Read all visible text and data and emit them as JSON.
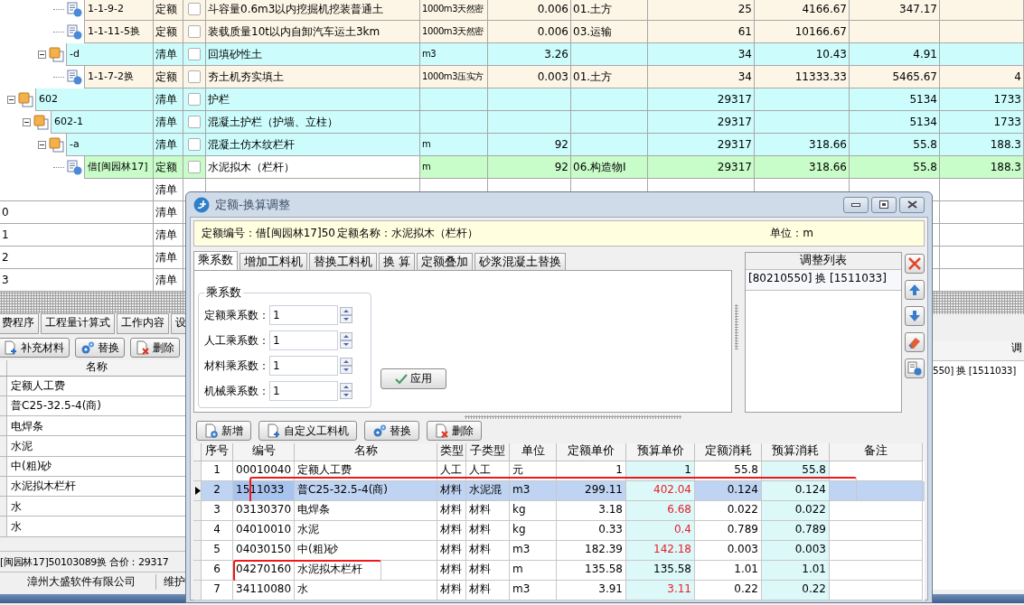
{
  "tree_grid": {
    "tree": [
      {
        "children": [
          {
            "children": [
              {
                "code": "1-1-9-2",
                "kind": "quota",
                "type": "定额",
                "checked": false,
                "name": "斗容量0.6m3以内挖掘机挖装普通土",
                "unit": "1000m3天然密",
                "qty": "0.006",
                "category": "01.土方",
                "col_8": "25",
                "col_9": "4166.67",
                "col_10": "347.17",
                "current": false
              },
              {
                "code": "1-1-11-5换",
                "kind": "quota",
                "type": "定额",
                "checked": false,
                "name": "装载质量10t以内自卸汽车运土3km",
                "unit": "1000m3天然密",
                "qty": "0.006",
                "category": "03.运输",
                "col_8": "61",
                "col_9": "10166.67",
                "current": false
              }
            ]
          },
          {
            "code": "-d",
            "kind": "list",
            "type": "清单",
            "checked": false,
            "expanded": true,
            "name": "回填砂性土",
            "unit": "m3",
            "qty": "3.26",
            "col_8": "34",
            "col_9": "10.43",
            "col_10": "4.91",
            "current": false,
            "children": [
              {
                "code": "1-1-7-2换",
                "kind": "quota",
                "type": "定额",
                "checked": false,
                "name": "夯土机夯实填土",
                "unit": "1000m3压实方",
                "qty": "0.003",
                "category": "01.土方",
                "col_8": "34",
                "col_9": "11333.33",
                "col_10": "5465.67",
                "col_11": "4",
                "current": false
              }
            ]
          }
        ]
      },
      {
        "code": "602",
        "kind": "list",
        "type": "清单",
        "checked": false,
        "expanded": true,
        "name": "护栏",
        "col_8": "29317",
        "col_10": "5134",
        "col_11": "1733",
        "current": false,
        "children": [
          {
            "code": "602-1",
            "kind": "list",
            "type": "清单",
            "checked": false,
            "expanded": true,
            "name": "混凝土护栏（护墙、立柱）",
            "col_8": "29317",
            "col_10": "5134",
            "col_11": "1733",
            "current": false,
            "children": [
              {
                "code": "-a",
                "kind": "list",
                "type": "清单",
                "checked": false,
                "expanded": true,
                "name": "混凝土仿木纹栏杆",
                "unit": "m",
                "qty": "92",
                "col_8": "29317",
                "col_9": "318.66",
                "col_10": "55.8",
                "col_11": "188.3",
                "current": false,
                "children": [
                  {
                    "code": "借[闽园林17]",
                    "kind": "quota",
                    "type": "定额",
                    "checked": false,
                    "name": "水泥拟木（栏杆）",
                    "unit": "m",
                    "qty": "92",
                    "category": "06.构造物Ⅰ",
                    "col_8": "29317",
                    "col_9": "318.66",
                    "col_10": "55.8",
                    "col_11": "188.3",
                    "current": true
                  }
                ]
              }
            ]
          }
        ]
      }
    ],
    "rows": [
      {
        "type": "清单"
      },
      {
        "code": "0",
        "type": "清单"
      },
      {
        "code": "1",
        "type": "清单"
      },
      {
        "code": "2",
        "type": "清单"
      },
      {
        "code": "3",
        "type": "清单"
      }
    ]
  },
  "lower_left": {
    "tabs": [
      {
        "label": "费程序",
        "selected": false
      },
      {
        "label": "工程量计算式",
        "selected": false
      },
      {
        "label": "工作内容",
        "selected": false
      },
      {
        "label": "设",
        "selected": false
      }
    ],
    "toolbar": [
      {
        "kind": "add",
        "label": "补充材料"
      },
      {
        "kind": "replace",
        "label": "替换"
      },
      {
        "kind": "delete",
        "label": "删除"
      }
    ],
    "column_header": "名称",
    "items": [
      "定额人工费",
      "普C25-32.5-4(商)",
      "电焊条",
      "水泥",
      "中(粗)砂",
      "水泥拟木栏杆",
      "水",
      "水"
    ],
    "summary": "[闽园林17]50103089换 合价：29317"
  },
  "status_bar": [
    "漳州大盛软件有限公司",
    "维护"
  ],
  "lower_right": {
    "header": "调",
    "item": "550] 换 [1511033]"
  },
  "dialog": {
    "title": "定额-换算调整",
    "info_code": "定额编号：借[闽园林17]50",
    "info_name": "定额名称：水泥拟木（栏杆）",
    "info_unit": "单位：m",
    "tabs": [
      {
        "label": "乘系数",
        "selected": true
      },
      {
        "label": "增加工料机",
        "selected": false
      },
      {
        "label": "替换工料机",
        "selected": false
      },
      {
        "label": "换 算",
        "selected": false
      },
      {
        "label": "定额叠加",
        "selected": false
      },
      {
        "label": "砂浆混凝土替换",
        "selected": false
      }
    ],
    "group_title": "乘系数",
    "fields": [
      {
        "label": "定额乘系数：",
        "value": "1"
      },
      {
        "label": "人工乘系数：",
        "value": "1"
      },
      {
        "label": "材料乘系数：",
        "value": "1"
      },
      {
        "label": "机械乘系数：",
        "value": "1"
      }
    ],
    "apply_button": "应用",
    "adjust_list": {
      "header": "调整列表",
      "items": [
        "[80210550] 换 [1511033]"
      ]
    },
    "side_buttons": [
      {
        "kind": "delete"
      },
      {
        "kind": "up"
      },
      {
        "kind": "down"
      },
      {
        "kind": "erase"
      },
      {
        "kind": "document"
      }
    ],
    "toolbar": [
      {
        "kind": "new",
        "label": "新增"
      },
      {
        "kind": "add",
        "label": "自定义工料机"
      },
      {
        "kind": "replace",
        "label": "替换"
      },
      {
        "kind": "delete",
        "label": "删除"
      }
    ],
    "columns": [
      "序号",
      "编号",
      "名称",
      "类型",
      "子类型",
      "单位",
      "定额单价",
      "预算单价",
      "定额消耗",
      "预算消耗",
      "备注"
    ],
    "rows": [
      {
        "no": "1",
        "code": "00010040",
        "name": "定额人工费",
        "type": "人工",
        "subtype": "人工",
        "unit": "元",
        "quota_price": "1",
        "budget_price": "1",
        "quota_use": "55.8",
        "budget_use": "55.8",
        "selected": false,
        "changed": false
      },
      {
        "no": "2",
        "code": "1511033",
        "name": "普C25-32.5-4(商)",
        "type": "材料",
        "subtype": "水泥混",
        "unit": "m3",
        "quota_price": "299.11",
        "budget_price": "402.04",
        "quota_use": "0.124",
        "budget_use": "0.124",
        "selected": true,
        "changed": true,
        "framed": true
      },
      {
        "no": "3",
        "code": "03130370",
        "name": "电焊条",
        "type": "材料",
        "subtype": "材料",
        "unit": "kg",
        "quota_price": "3.18",
        "budget_price": "6.68",
        "quota_use": "0.022",
        "budget_use": "0.022",
        "selected": false,
        "changed": true
      },
      {
        "no": "4",
        "code": "04010010",
        "name": "水泥",
        "type": "材料",
        "subtype": "材料",
        "unit": "kg",
        "quota_price": "0.33",
        "budget_price": "0.4",
        "quota_use": "0.789",
        "budget_use": "0.789",
        "selected": false,
        "changed": true
      },
      {
        "no": "5",
        "code": "04030150",
        "name": "中(粗)砂",
        "type": "材料",
        "subtype": "材料",
        "unit": "m3",
        "quota_price": "182.39",
        "budget_price": "142.18",
        "quota_use": "0.003",
        "budget_use": "0.003",
        "selected": false,
        "changed": true
      },
      {
        "no": "6",
        "code": "04270160",
        "name": "水泥拟木栏杆",
        "type": "材料",
        "subtype": "材料",
        "unit": "m",
        "quota_price": "135.58",
        "budget_price": "135.58",
        "quota_use": "1.01",
        "budget_use": "1.01",
        "selected": false,
        "changed": false,
        "framed": true
      },
      {
        "no": "7",
        "code": "34110080",
        "name": "水",
        "type": "材料",
        "subtype": "材料",
        "unit": "m3",
        "quota_price": "3.91",
        "budget_price": "3.11",
        "quota_use": "0.22",
        "budget_use": "0.22",
        "selected": false,
        "changed": true
      }
    ]
  }
}
